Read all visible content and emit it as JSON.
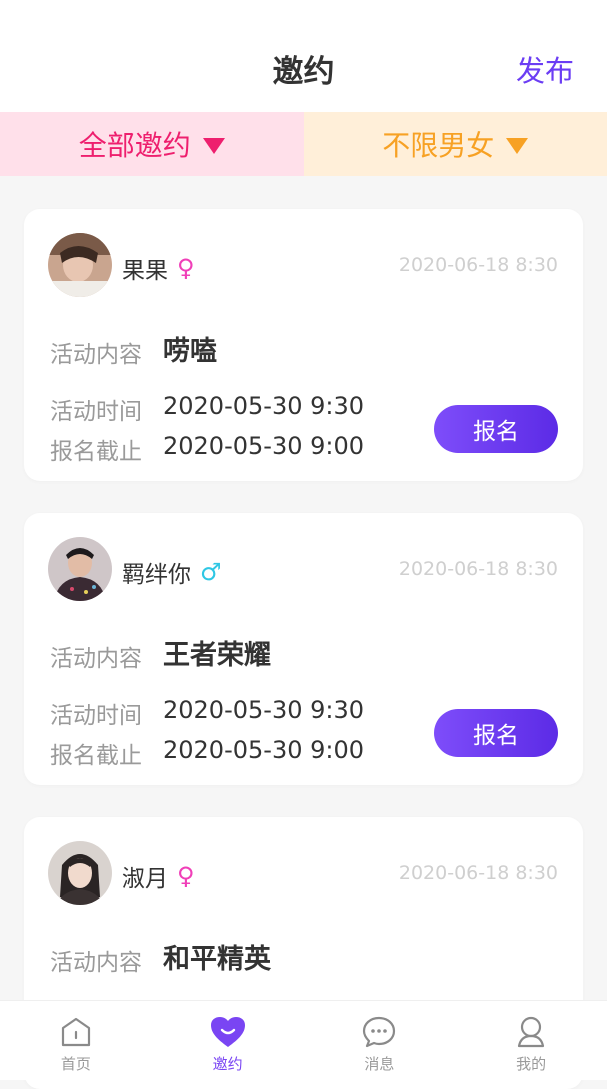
{
  "header": {
    "title": "邀约",
    "publish_label": "发布"
  },
  "filters": {
    "all_label": "全部邀约",
    "gender_label": "不限男女"
  },
  "labels": {
    "content": "活动内容",
    "time": "活动时间",
    "deadline": "报名截止",
    "signup": "报名"
  },
  "posts": [
    {
      "name": "果果",
      "gender": "female",
      "gender_symbol": "♀",
      "posted_at": "2020-06-18 8:30",
      "content": "唠嗑",
      "activity_time": "2020-05-30  9:30",
      "deadline": "2020-05-30  9:00"
    },
    {
      "name": "羁绊你",
      "gender": "male",
      "gender_symbol": "♂",
      "posted_at": "2020-06-18 8:30",
      "content": "王者荣耀",
      "activity_time": "2020-05-30  9:30",
      "deadline": "2020-05-30  9:00"
    },
    {
      "name": "淑月",
      "gender": "female",
      "gender_symbol": "♀",
      "posted_at": "2020-06-18 8:30",
      "content": "和平精英"
    }
  ],
  "tabbar": {
    "items": [
      {
        "label": "首页",
        "icon": "home-icon"
      },
      {
        "label": "邀约",
        "icon": "heart-icon",
        "active": true
      },
      {
        "label": "消息",
        "icon": "chat-icon"
      },
      {
        "label": "我的",
        "icon": "user-icon"
      }
    ]
  },
  "colors": {
    "accent": "#6b3df4",
    "filter_all_text": "#ee1f6e",
    "filter_all_bg": "#ffe0ea",
    "filter_gender_text": "#f7a124",
    "filter_gender_bg": "#ffefd9",
    "female": "#f03fb8",
    "male": "#2fc7e4"
  }
}
